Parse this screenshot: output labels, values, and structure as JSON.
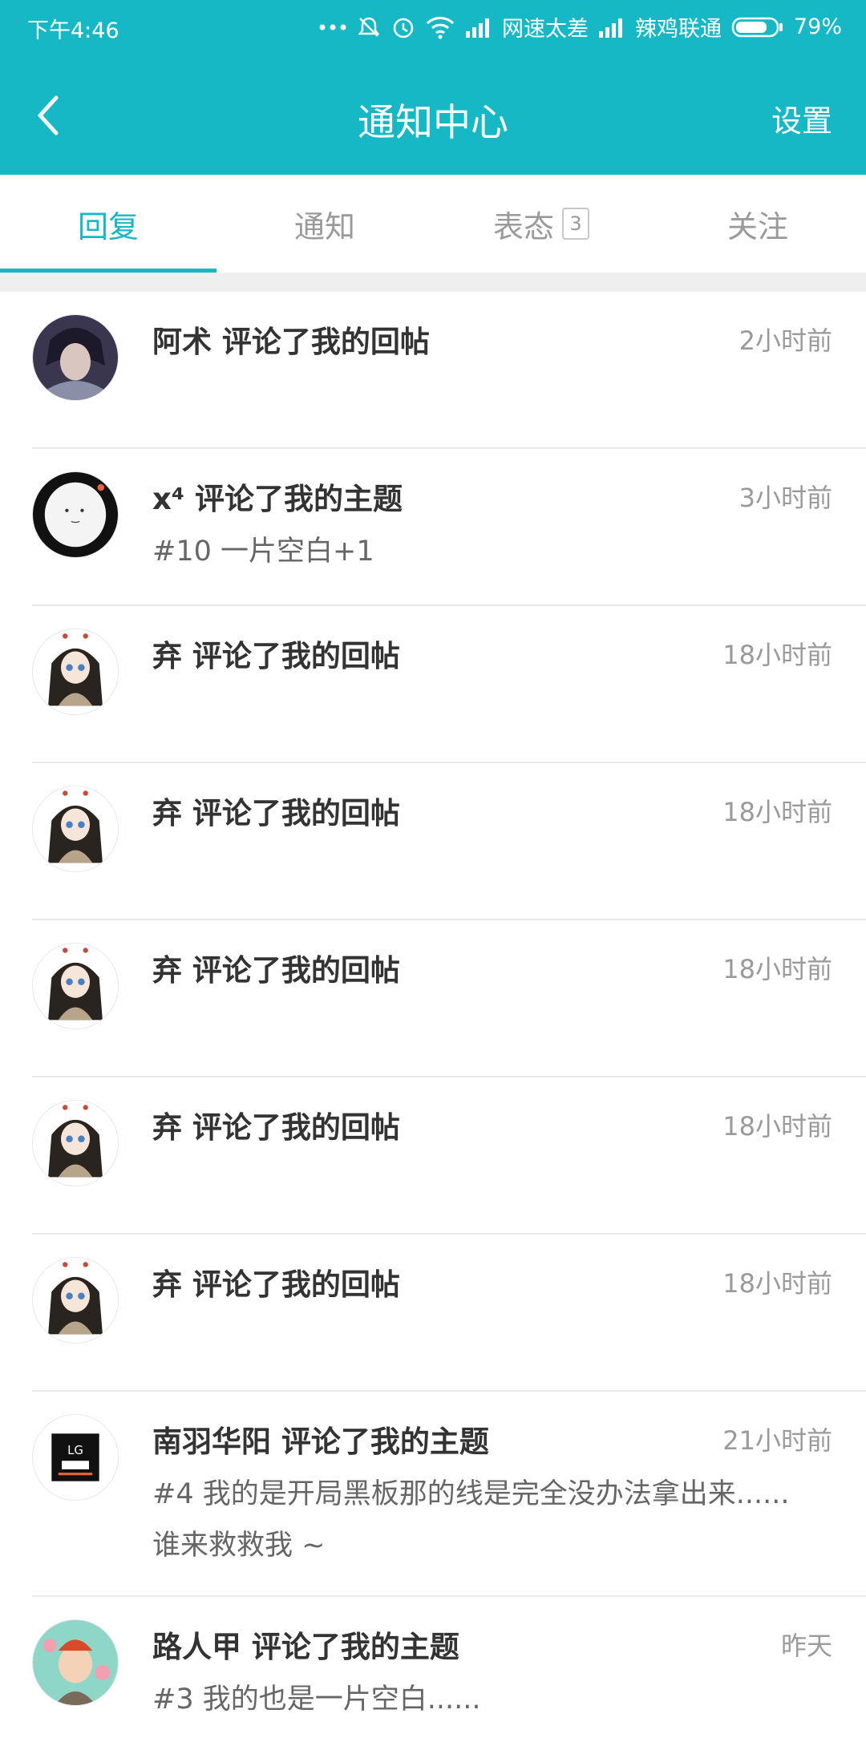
{
  "status": {
    "time": "下午4:46",
    "net_label": "网速太差",
    "carrier": "辣鸡联通",
    "battery": "79%",
    "battery_level": 0.79
  },
  "nav": {
    "title": "通知中心",
    "settings": "设置"
  },
  "tabs": [
    {
      "label": "回复",
      "active": true
    },
    {
      "label": "通知"
    },
    {
      "label": "表态",
      "badge": "3"
    },
    {
      "label": "关注"
    }
  ],
  "items": [
    {
      "title": "阿术 评论了我的回帖",
      "time": "2小时前",
      "preview": ""
    },
    {
      "title": "x⁴ 评论了我的主题",
      "time": "3小时前",
      "preview": "#10 一片空白+1"
    },
    {
      "title": "弃 评论了我的回帖",
      "time": "18小时前",
      "preview": ""
    },
    {
      "title": "弃 评论了我的回帖",
      "time": "18小时前",
      "preview": ""
    },
    {
      "title": "弃 评论了我的回帖",
      "time": "18小时前",
      "preview": ""
    },
    {
      "title": "弃 评论了我的回帖",
      "time": "18小时前",
      "preview": ""
    },
    {
      "title": "弃 评论了我的回帖",
      "time": "18小时前",
      "preview": ""
    },
    {
      "title": "南羽华阳 评论了我的主题",
      "time": "21小时前",
      "preview": "#4 我的是开局黑板那的线是完全没办法拿出来...... 谁来救救我 ~"
    },
    {
      "title": "路人甲 评论了我的主题",
      "time": "昨天",
      "preview": "#3 我的也是一片空白......"
    }
  ],
  "colors": {
    "accent": "#16b8c6",
    "divider": "#e8e8e8",
    "muted": "#9a9a9a"
  }
}
